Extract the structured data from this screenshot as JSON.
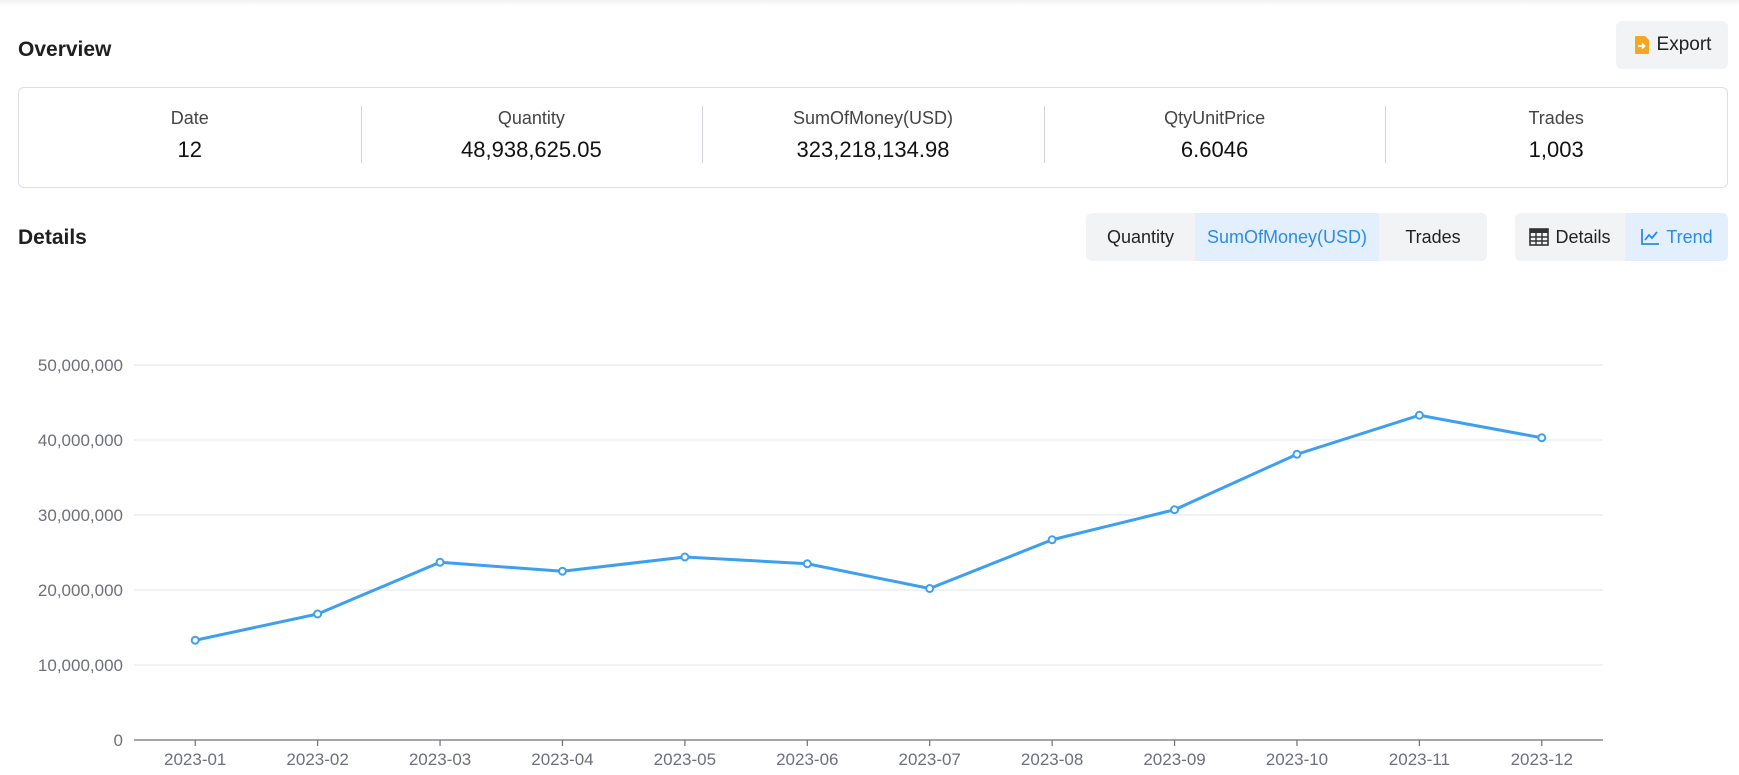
{
  "overview": {
    "title": "Overview",
    "export_label": "Export",
    "stats": [
      {
        "label": "Date",
        "value": "12"
      },
      {
        "label": "Quantity",
        "value": "48,938,625.05"
      },
      {
        "label": "SumOfMoney(USD)",
        "value": "323,218,134.98"
      },
      {
        "label": "QtyUnitPrice",
        "value": "6.6046"
      },
      {
        "label": "Trades",
        "value": "1,003"
      }
    ]
  },
  "details": {
    "title": "Details",
    "metric_tabs": [
      {
        "label": "Quantity",
        "active": false
      },
      {
        "label": "SumOfMoney(USD)",
        "active": true
      },
      {
        "label": "Trades",
        "active": false
      }
    ],
    "view_tabs": [
      {
        "label": "Details",
        "icon": "table-icon",
        "active": false
      },
      {
        "label": "Trend",
        "icon": "line-chart-icon",
        "active": true
      }
    ]
  },
  "colors": {
    "accent": "#2b8ce8",
    "line": "#3d9ff0",
    "export_icon": "#f5a623",
    "grid": "#e1e5ee",
    "axis": "#6e7079"
  },
  "chart_data": {
    "type": "line",
    "categories": [
      "2023-01",
      "2023-02",
      "2023-03",
      "2023-04",
      "2023-05",
      "2023-06",
      "2023-07",
      "2023-08",
      "2023-09",
      "2023-10",
      "2023-11",
      "2023-12"
    ],
    "series": [
      {
        "values": [
          13300000,
          16800000,
          23700000,
          22500000,
          24400000,
          23500000,
          20200000,
          26700000,
          30700000,
          38100000,
          43300000,
          40300000
        ]
      }
    ],
    "yticks": [
      "0",
      "10,000,000",
      "20,000,000",
      "30,000,000",
      "40,000,000",
      "50,000,000"
    ],
    "ylim": [
      0,
      50000000
    ],
    "grid": true,
    "title": "",
    "xlabel": "",
    "ylabel": ""
  }
}
